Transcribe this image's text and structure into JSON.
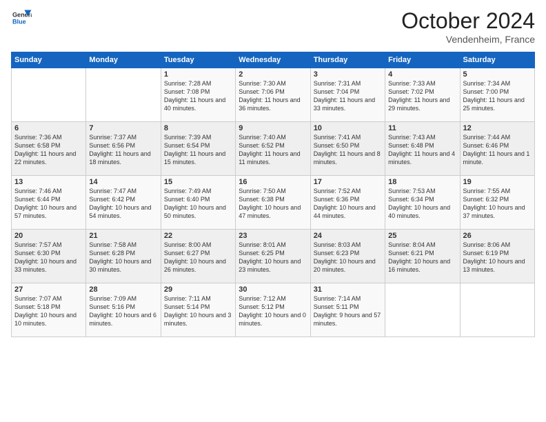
{
  "header": {
    "logo_general": "General",
    "logo_blue": "Blue",
    "month_title": "October 2024",
    "location": "Vendenheim, France"
  },
  "days_of_week": [
    "Sunday",
    "Monday",
    "Tuesday",
    "Wednesday",
    "Thursday",
    "Friday",
    "Saturday"
  ],
  "weeks": [
    [
      {
        "day": "",
        "sunrise": "",
        "sunset": "",
        "daylight": ""
      },
      {
        "day": "",
        "sunrise": "",
        "sunset": "",
        "daylight": ""
      },
      {
        "day": "1",
        "sunrise": "Sunrise: 7:28 AM",
        "sunset": "Sunset: 7:08 PM",
        "daylight": "Daylight: 11 hours and 40 minutes."
      },
      {
        "day": "2",
        "sunrise": "Sunrise: 7:30 AM",
        "sunset": "Sunset: 7:06 PM",
        "daylight": "Daylight: 11 hours and 36 minutes."
      },
      {
        "day": "3",
        "sunrise": "Sunrise: 7:31 AM",
        "sunset": "Sunset: 7:04 PM",
        "daylight": "Daylight: 11 hours and 33 minutes."
      },
      {
        "day": "4",
        "sunrise": "Sunrise: 7:33 AM",
        "sunset": "Sunset: 7:02 PM",
        "daylight": "Daylight: 11 hours and 29 minutes."
      },
      {
        "day": "5",
        "sunrise": "Sunrise: 7:34 AM",
        "sunset": "Sunset: 7:00 PM",
        "daylight": "Daylight: 11 hours and 25 minutes."
      }
    ],
    [
      {
        "day": "6",
        "sunrise": "Sunrise: 7:36 AM",
        "sunset": "Sunset: 6:58 PM",
        "daylight": "Daylight: 11 hours and 22 minutes."
      },
      {
        "day": "7",
        "sunrise": "Sunrise: 7:37 AM",
        "sunset": "Sunset: 6:56 PM",
        "daylight": "Daylight: 11 hours and 18 minutes."
      },
      {
        "day": "8",
        "sunrise": "Sunrise: 7:39 AM",
        "sunset": "Sunset: 6:54 PM",
        "daylight": "Daylight: 11 hours and 15 minutes."
      },
      {
        "day": "9",
        "sunrise": "Sunrise: 7:40 AM",
        "sunset": "Sunset: 6:52 PM",
        "daylight": "Daylight: 11 hours and 11 minutes."
      },
      {
        "day": "10",
        "sunrise": "Sunrise: 7:41 AM",
        "sunset": "Sunset: 6:50 PM",
        "daylight": "Daylight: 11 hours and 8 minutes."
      },
      {
        "day": "11",
        "sunrise": "Sunrise: 7:43 AM",
        "sunset": "Sunset: 6:48 PM",
        "daylight": "Daylight: 11 hours and 4 minutes."
      },
      {
        "day": "12",
        "sunrise": "Sunrise: 7:44 AM",
        "sunset": "Sunset: 6:46 PM",
        "daylight": "Daylight: 11 hours and 1 minute."
      }
    ],
    [
      {
        "day": "13",
        "sunrise": "Sunrise: 7:46 AM",
        "sunset": "Sunset: 6:44 PM",
        "daylight": "Daylight: 10 hours and 57 minutes."
      },
      {
        "day": "14",
        "sunrise": "Sunrise: 7:47 AM",
        "sunset": "Sunset: 6:42 PM",
        "daylight": "Daylight: 10 hours and 54 minutes."
      },
      {
        "day": "15",
        "sunrise": "Sunrise: 7:49 AM",
        "sunset": "Sunset: 6:40 PM",
        "daylight": "Daylight: 10 hours and 50 minutes."
      },
      {
        "day": "16",
        "sunrise": "Sunrise: 7:50 AM",
        "sunset": "Sunset: 6:38 PM",
        "daylight": "Daylight: 10 hours and 47 minutes."
      },
      {
        "day": "17",
        "sunrise": "Sunrise: 7:52 AM",
        "sunset": "Sunset: 6:36 PM",
        "daylight": "Daylight: 10 hours and 44 minutes."
      },
      {
        "day": "18",
        "sunrise": "Sunrise: 7:53 AM",
        "sunset": "Sunset: 6:34 PM",
        "daylight": "Daylight: 10 hours and 40 minutes."
      },
      {
        "day": "19",
        "sunrise": "Sunrise: 7:55 AM",
        "sunset": "Sunset: 6:32 PM",
        "daylight": "Daylight: 10 hours and 37 minutes."
      }
    ],
    [
      {
        "day": "20",
        "sunrise": "Sunrise: 7:57 AM",
        "sunset": "Sunset: 6:30 PM",
        "daylight": "Daylight: 10 hours and 33 minutes."
      },
      {
        "day": "21",
        "sunrise": "Sunrise: 7:58 AM",
        "sunset": "Sunset: 6:28 PM",
        "daylight": "Daylight: 10 hours and 30 minutes."
      },
      {
        "day": "22",
        "sunrise": "Sunrise: 8:00 AM",
        "sunset": "Sunset: 6:27 PM",
        "daylight": "Daylight: 10 hours and 26 minutes."
      },
      {
        "day": "23",
        "sunrise": "Sunrise: 8:01 AM",
        "sunset": "Sunset: 6:25 PM",
        "daylight": "Daylight: 10 hours and 23 minutes."
      },
      {
        "day": "24",
        "sunrise": "Sunrise: 8:03 AM",
        "sunset": "Sunset: 6:23 PM",
        "daylight": "Daylight: 10 hours and 20 minutes."
      },
      {
        "day": "25",
        "sunrise": "Sunrise: 8:04 AM",
        "sunset": "Sunset: 6:21 PM",
        "daylight": "Daylight: 10 hours and 16 minutes."
      },
      {
        "day": "26",
        "sunrise": "Sunrise: 8:06 AM",
        "sunset": "Sunset: 6:19 PM",
        "daylight": "Daylight: 10 hours and 13 minutes."
      }
    ],
    [
      {
        "day": "27",
        "sunrise": "Sunrise: 7:07 AM",
        "sunset": "Sunset: 5:18 PM",
        "daylight": "Daylight: 10 hours and 10 minutes."
      },
      {
        "day": "28",
        "sunrise": "Sunrise: 7:09 AM",
        "sunset": "Sunset: 5:16 PM",
        "daylight": "Daylight: 10 hours and 6 minutes."
      },
      {
        "day": "29",
        "sunrise": "Sunrise: 7:11 AM",
        "sunset": "Sunset: 5:14 PM",
        "daylight": "Daylight: 10 hours and 3 minutes."
      },
      {
        "day": "30",
        "sunrise": "Sunrise: 7:12 AM",
        "sunset": "Sunset: 5:12 PM",
        "daylight": "Daylight: 10 hours and 0 minutes."
      },
      {
        "day": "31",
        "sunrise": "Sunrise: 7:14 AM",
        "sunset": "Sunset: 5:11 PM",
        "daylight": "Daylight: 9 hours and 57 minutes."
      },
      {
        "day": "",
        "sunrise": "",
        "sunset": "",
        "daylight": ""
      },
      {
        "day": "",
        "sunrise": "",
        "sunset": "",
        "daylight": ""
      }
    ]
  ]
}
